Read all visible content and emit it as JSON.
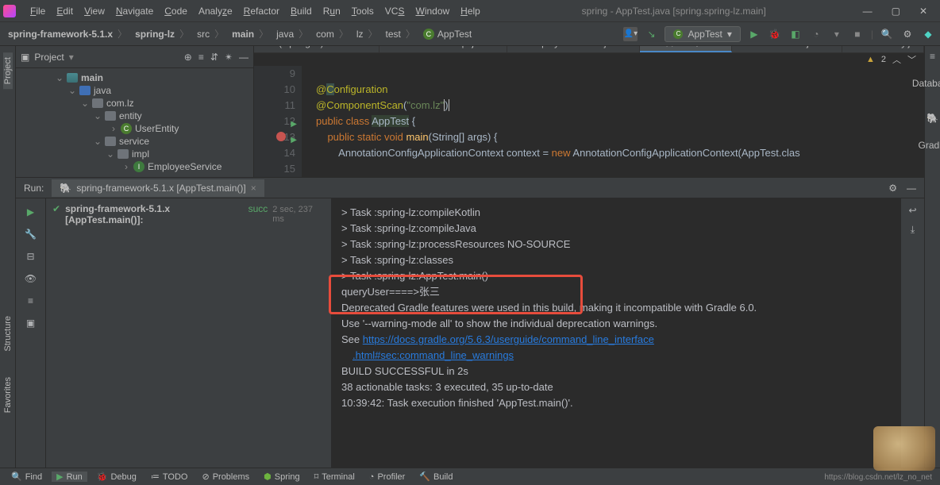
{
  "title": "spring - AppTest.java [spring.spring-lz.main]",
  "menu": [
    "File",
    "Edit",
    "View",
    "Navigate",
    "Code",
    "Analyze",
    "Refactor",
    "Build",
    "Run",
    "Tools",
    "VCS",
    "Window",
    "Help"
  ],
  "breadcrumbs": [
    "spring-framework-5.1.x",
    "spring-lz",
    "src",
    "main",
    "java",
    "com",
    "lz",
    "test",
    "AppTest"
  ],
  "runconfig": "AppTest",
  "project": {
    "label": "Project"
  },
  "tree": {
    "main": "main",
    "java": "java",
    "comlz": "com.lz",
    "entity": "entity",
    "userentity": "UserEntity",
    "service": "service",
    "impl": "impl",
    "empservice": "EmployeeService"
  },
  "tabs": [
    {
      "label": "build.gradle (:spring-lz)"
    },
    {
      "label": "UserServiceImpl.java"
    },
    {
      "label": "EmployeeService.java"
    },
    {
      "label": "AppTest.java",
      "active": true
    },
    {
      "label": "UserService.java"
    },
    {
      "label": "UserEntity.ja"
    }
  ],
  "inspection": {
    "warn": "2"
  },
  "code": {
    "l9": "",
    "l10a": "@",
    "l10b": "onfiguration",
    "l11a": "@ComponentScan",
    "l11b": "(",
    "l11c": "\"com.lz\"",
    "l11d": ")",
    "l12a": "public class ",
    "l12b": "AppTest",
    "l12c": " {",
    "l13a": "    public static void ",
    "l13b": "main",
    "l13c": "(String[] args) {",
    "l14a": "        AnnotationConfigApplicationContext context = ",
    "l14b": "new ",
    "l14c": "AnnotationConfigApplicationContext(AppTest.clas",
    "l15": ""
  },
  "run": {
    "label": "Run:",
    "tab": "spring-framework-5.1.x [AppTest.main()]",
    "tree": "spring-framework-5.1.x [AppTest.main()]:",
    "treestat": "succ",
    "treetime": "2 sec, 237 ms"
  },
  "out": {
    "l1": "> Task :spring-lz:compileKotlin",
    "l2": "> Task :spring-lz:compileJava",
    "l3": "> Task :spring-lz:processResources NO-SOURCE",
    "l4": "> Task :spring-lz:classes",
    "l5": "",
    "l6": "> Task :spring-lz:AppTest.main()",
    "l7": "queryUser====>张三",
    "l8": "",
    "l9": "Deprecated Gradle features were used in this build, making it incompatible with Gradle 6.0.",
    "l10": "Use '--warning-mode all' to show the individual deprecation warnings.",
    "l11a": "See ",
    "l11b": "https://docs.gradle.org/5.6.3/userguide/command_line_interface",
    "l12": ".html#sec:command_line_warnings",
    "l13": "",
    "l14": "BUILD SUCCESSFUL in 2s",
    "l15": "38 actionable tasks: 3 executed, 35 up-to-date",
    "l16": "10:39:42: Task execution finished 'AppTest.main()'."
  },
  "status": {
    "find": "Find",
    "run": "Run",
    "debug": "Debug",
    "todo": "TODO",
    "problems": "Problems",
    "spring": "Spring",
    "terminal": "Terminal",
    "profiler": "Profiler",
    "build": "Build"
  },
  "side": {
    "project": "Project",
    "structure": "Structure",
    "favorites": "Favorites",
    "database": "Database",
    "gradle": "Gradle"
  },
  "footer_url": "https://blog.csdn.net/lz_no_net"
}
